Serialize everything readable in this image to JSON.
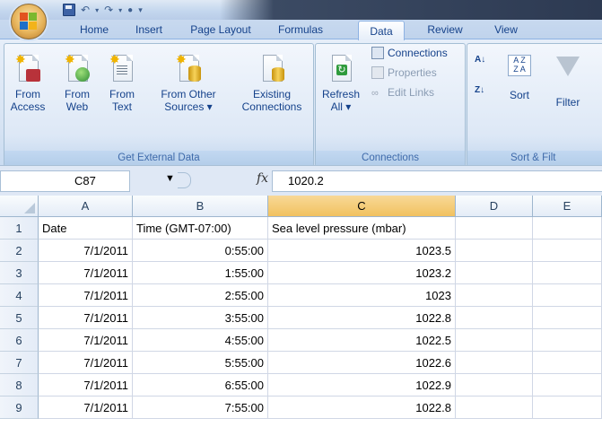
{
  "tabs": [
    "Home",
    "Insert",
    "Page Layout",
    "Formulas",
    "Data",
    "Review",
    "View"
  ],
  "active_tab": "Data",
  "ribbon": {
    "get_external": {
      "label": "Get External Data",
      "buttons": [
        {
          "line1": "From",
          "line2": "Access"
        },
        {
          "line1": "From",
          "line2": "Web"
        },
        {
          "line1": "From",
          "line2": "Text"
        },
        {
          "line1": "From Other",
          "line2": "Sources ▾"
        },
        {
          "line1": "Existing",
          "line2": "Connections"
        }
      ]
    },
    "connections": {
      "label": "Connections",
      "refresh_line1": "Refresh",
      "refresh_line2": "All ▾",
      "connections": "Connections",
      "properties": "Properties",
      "edit_links": "Edit Links"
    },
    "sort_filter": {
      "label": "Sort & Filt",
      "sort": "Sort",
      "filter": "Filter"
    }
  },
  "formula_bar": {
    "name_box": "C87",
    "fx": "fx",
    "value": "1020.2"
  },
  "columns": [
    "A",
    "B",
    "C",
    "D",
    "E"
  ],
  "selected_column": "C",
  "rows": [
    {
      "n": "1",
      "a": "Date",
      "b": "Time (GMT-07:00)",
      "c": "Sea level pressure (mbar)"
    },
    {
      "n": "2",
      "a": "7/1/2011",
      "b": "0:55:00",
      "c": "1023.5"
    },
    {
      "n": "3",
      "a": "7/1/2011",
      "b": "1:55:00",
      "c": "1023.2"
    },
    {
      "n": "4",
      "a": "7/1/2011",
      "b": "2:55:00",
      "c": "1023"
    },
    {
      "n": "5",
      "a": "7/1/2011",
      "b": "3:55:00",
      "c": "1022.8"
    },
    {
      "n": "6",
      "a": "7/1/2011",
      "b": "4:55:00",
      "c": "1022.5"
    },
    {
      "n": "7",
      "a": "7/1/2011",
      "b": "5:55:00",
      "c": "1022.6"
    },
    {
      "n": "8",
      "a": "7/1/2011",
      "b": "6:55:00",
      "c": "1022.9"
    },
    {
      "n": "9",
      "a": "7/1/2011",
      "b": "7:55:00",
      "c": "1022.8"
    }
  ]
}
